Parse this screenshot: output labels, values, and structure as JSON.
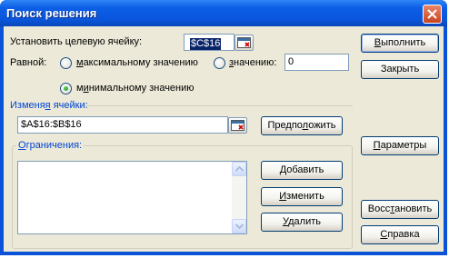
{
  "window": {
    "title": "Поиск решения"
  },
  "target": {
    "label": "Установить целевую ячейку:",
    "value": "$C$16"
  },
  "equal": {
    "label": "Равной:"
  },
  "options": {
    "max": {
      "pre": "",
      "hotkey": "м",
      "post": "аксимальному значению"
    },
    "value": {
      "pre": "",
      "hotkey": "з",
      "post": "начению:",
      "input": "0"
    },
    "min": {
      "pre": "м",
      "hotkey": "и",
      "post": "нимальному значению"
    }
  },
  "changing": {
    "pre": "Изменя",
    "hotkey": "я",
    "post": " ячейки:",
    "value": "$A$16:$B$16"
  },
  "constraints": {
    "pre": "",
    "hotkey": "О",
    "post": "граничения:"
  },
  "buttons": {
    "guess": {
      "pre": "Предпо",
      "hotkey": "л",
      "post": "ожить"
    },
    "add": {
      "pre": "",
      "hotkey": "Д",
      "post": "обавить"
    },
    "change": {
      "pre": "",
      "hotkey": "И",
      "post": "зменить"
    },
    "delete": {
      "pre": "",
      "hotkey": "У",
      "post": "далить"
    },
    "execute": {
      "pre": "",
      "hotkey": "В",
      "post": "ыполнить"
    },
    "close": {
      "pre": "Закрыть",
      "hotkey": "",
      "post": ""
    },
    "params": {
      "pre": "",
      "hotkey": "П",
      "post": "араметры"
    },
    "restore": {
      "pre": "Восс",
      "hotkey": "т",
      "post": "ановить"
    },
    "help": {
      "pre": "",
      "hotkey": "С",
      "post": "правка"
    }
  },
  "colors": {
    "titlebar": "#0a55dc",
    "client": "#ece9d8",
    "group_label": "#0046d5",
    "selection": "#0a246a"
  }
}
